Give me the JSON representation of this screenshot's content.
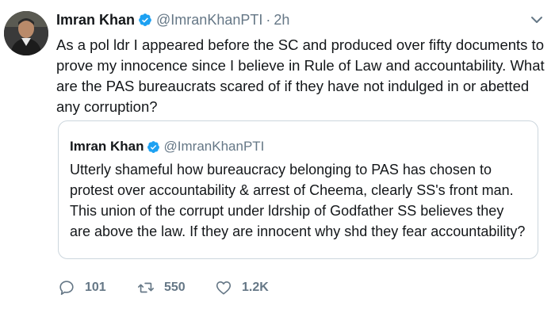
{
  "tweet": {
    "author_name": "Imran Khan",
    "author_handle": "@ImranKhanPTI",
    "separator": "·",
    "time": "2h",
    "text": "As a pol ldr I appeared before the SC and produced over fifty documents to prove my innocence since I believe in Rule of Law and accountability. What are the PAS bureaucrats scared of if they have not indulged in or abetted any corruption?",
    "verified_icon": "verified-badge-icon",
    "menu_icon": "chevron-down-icon"
  },
  "quoted_tweet": {
    "author_name": "Imran Khan",
    "author_handle": "@ImranKhanPTI",
    "text": "Utterly shameful how bureaucracy belonging to PAS has chosen to protest over accountability & arrest of Cheema, clearly SS's front man. This union of the corrupt under ldrship of Godfather SS believes they are above the law. If they are innocent why shd they fear accountability?"
  },
  "actions": {
    "reply_count": "101",
    "retweet_count": "550",
    "like_count": "1.2K"
  },
  "colors": {
    "verified": "#1da1f2",
    "muted": "#657786",
    "border": "#ccd6dd"
  }
}
